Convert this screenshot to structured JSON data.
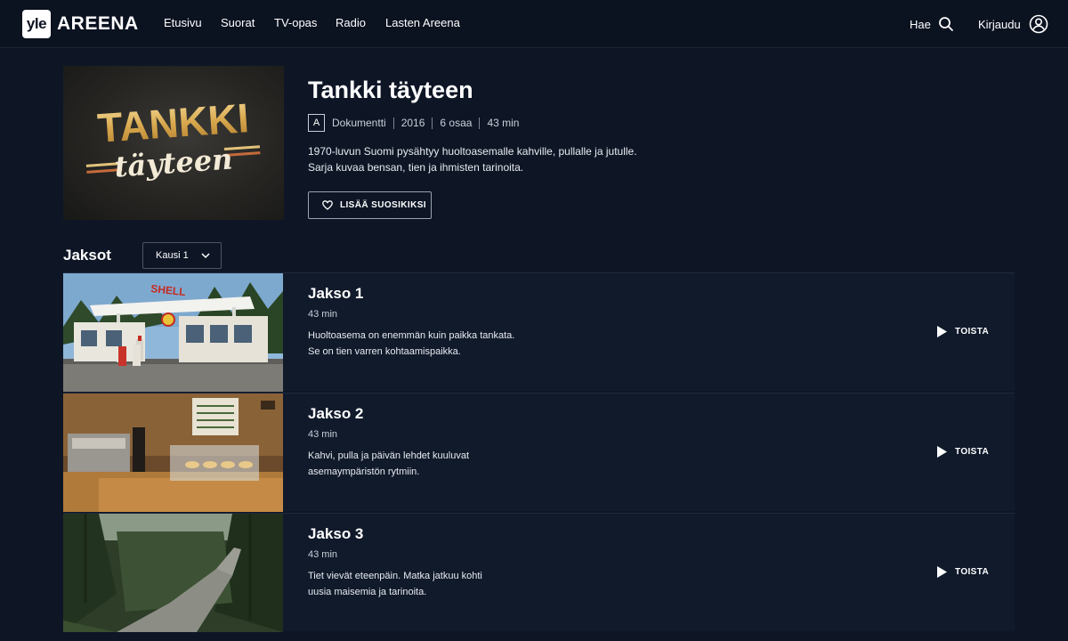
{
  "header": {
    "logo_mark": "yle",
    "logo_text": "AREENA",
    "nav": [
      "Etusivu",
      "Suorat",
      "TV-opas",
      "Radio",
      "Lasten Areena"
    ],
    "search_label": "Hae",
    "login_label": "Kirjaudu"
  },
  "hero": {
    "image_title_top": "TANKKI",
    "image_title_bottom": "täyteen",
    "title": "Tankki täyteen",
    "rating": "A",
    "genre": "Dokumentti",
    "year": "2016",
    "episodes_count": "6 osaa",
    "duration": "43 min",
    "description_line1": "1970-luvun Suomi pysähtyy huoltoasemalle kahville, pullalle ja jutulle.",
    "description_line2": "Sarja kuvaa bensan, tien ja ihmisten tarinoita.",
    "favorite_label": "LISÄÄ SUOSIKIKSI"
  },
  "episodes_section": {
    "title": "Jaksot",
    "season_selected": "Kausi 1"
  },
  "episodes": [
    {
      "title": "Jakso 1",
      "duration": "43 min",
      "line1": "Huoltoasema on enemmän kuin paikka tankata.",
      "line2": "Se on tien varren kohtaamispaikka.",
      "play": "TOISTA",
      "sign": "SHELL"
    },
    {
      "title": "Jakso 2",
      "duration": "43 min",
      "line1": "Kahvi, pulla ja päivän lehdet kuuluvat",
      "line2": "asemaympäristön rytmiin.",
      "play": "TOISTA"
    },
    {
      "title": "Jakso 3",
      "duration": "43 min",
      "line1": "Tiet vievät eteenpäin. Matka jatkuu kohti",
      "line2": "uusia maisemia ja tarinoita.",
      "play": "TOISTA"
    }
  ]
}
